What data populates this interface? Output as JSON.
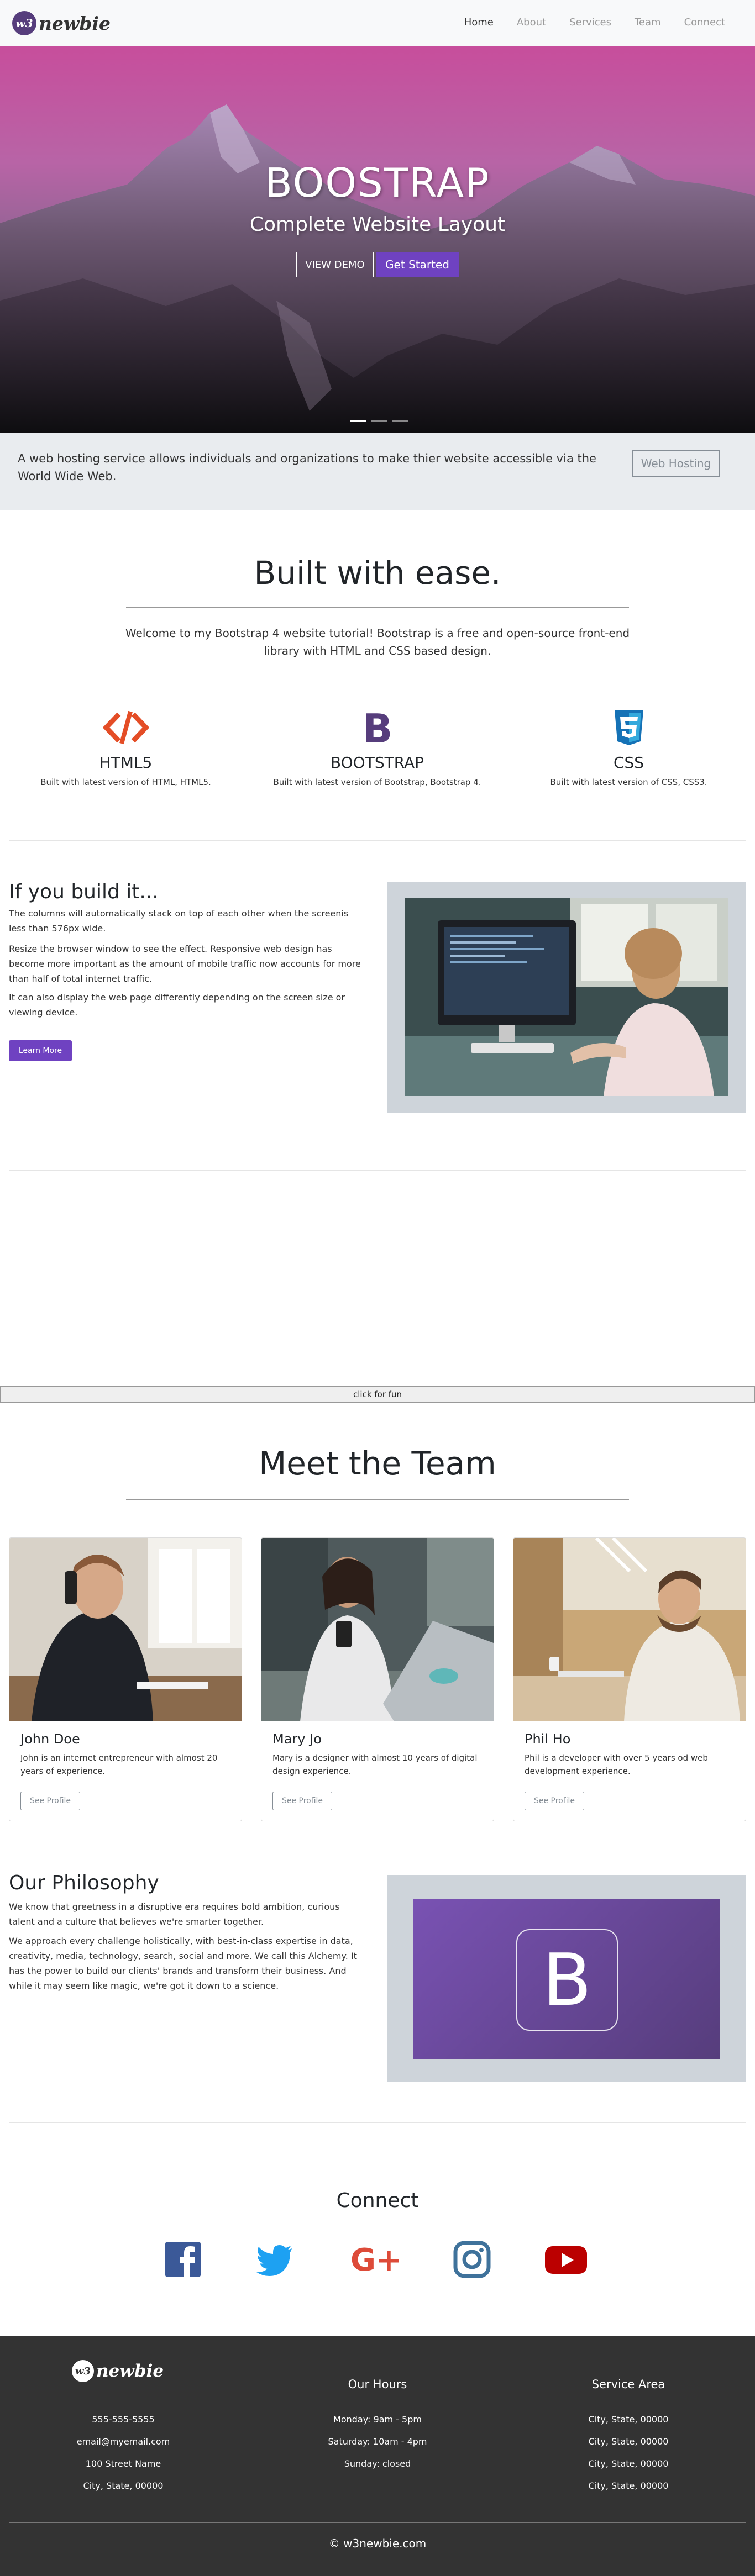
{
  "nav": {
    "logo_badge": "w3",
    "logo_text": "newbie",
    "links": [
      "Home",
      "About",
      "Services",
      "Team",
      "Connect"
    ]
  },
  "hero": {
    "title": "BOOSTRAP",
    "subtitle": "Complete Website Layout",
    "demo_button": "VIEW DEMO",
    "start_button": "Get Started",
    "active_slide": 1,
    "slide_count": 3
  },
  "jumbotron": {
    "text": "A web hosting service allows individuals and organizations to make thier website accessible via the World Wide Web.",
    "button": "Web Hosting"
  },
  "welcome": {
    "title": "Built with ease.",
    "lead": "Welcome to my Bootstrap 4 website tutorial! Bootstrap is a free and open-source front-end library with HTML and CSS based design.",
    "features": [
      {
        "icon": "html5-icon",
        "title": "HTML5",
        "text": "Built with latest version of HTML, HTML5.",
        "color": "#e44d26"
      },
      {
        "icon": "bootstrap-icon",
        "title": "BOOTSTRAP",
        "text": "Built with latest version of Bootstrap, Bootstrap 4.",
        "color": "#563d7c"
      },
      {
        "icon": "css3-icon",
        "title": "CSS",
        "text": "Built with latest version of CSS, CSS3.",
        "color": "#1572b6"
      }
    ]
  },
  "build": {
    "title": "If you build it...",
    "p1": "The columns will automatically stack on top of each other when the screenis less than 576px wide.",
    "p2": "Resize the browser window to see the effect. Responsive web design has become more important as the amount of mobile traffic now accounts for more than half of total internet traffic.",
    "p3": "It can also display the web page differently depending on the screen size or viewing device.",
    "button": "Learn More"
  },
  "fun_button": "click for fun",
  "team": {
    "title": "Meet the Team",
    "members": [
      {
        "name": "John Doe",
        "bio": "John is an internet entrepreneur with almost 20 years of experience.",
        "button": "See Profile"
      },
      {
        "name": "Mary Jo",
        "bio": "Mary is a designer with almost 10 years of digital design experience.",
        "button": "See Profile"
      },
      {
        "name": "Phil Ho",
        "bio": "Phil is a developer with over 5 years od web development experience.",
        "button": "See Profile"
      }
    ]
  },
  "philosophy": {
    "title": "Our Philosophy",
    "p1": "We know that greetness in a disruptive era requires bold ambition, curious talent and a culture that believes we're smarter together.",
    "p2": "We approach every challenge holistically, with best-in-class expertise in data, creativity, media, technology, search, social and more. We call this Alchemy. It has the power to build our clients' brands and transform their business. And while it may seem like magic, we're got it down to a science.",
    "logo_letter": "B"
  },
  "connect": {
    "title": "Connect",
    "icons": [
      "facebook-icon",
      "twitter-icon",
      "google-plus-icon",
      "instagram-icon",
      "youtube-icon"
    ]
  },
  "footer": {
    "logo_badge": "w3",
    "logo_text": "newbie",
    "contact": [
      "555-555-5555",
      "email@myemail.com",
      "100 Street Name",
      "City, State, 00000"
    ],
    "hours_title": "Our Hours",
    "hours": [
      "Monday: 9am - 5pm",
      "Saturday: 10am - 4pm",
      "Sunday: closed"
    ],
    "area_title": "Service Area",
    "areas": [
      "City, State, 00000",
      "City, State, 00000",
      "City, State, 00000",
      "City, State, 00000"
    ],
    "copyright": "© w3newbie.com"
  },
  "colors": {
    "accent": "#6f42c1",
    "footer_bg": "#333333",
    "jumbotron_bg": "#e9ecef"
  }
}
